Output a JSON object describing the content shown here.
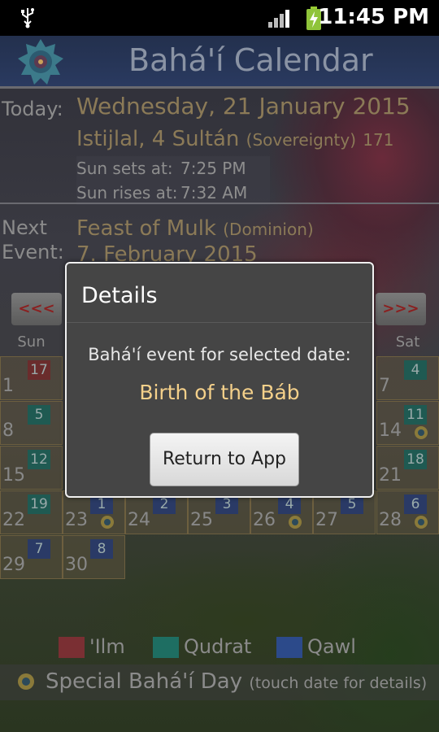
{
  "status": {
    "time": "11:45 PM"
  },
  "app": {
    "title": "Bahá'í Calendar"
  },
  "today": {
    "label": "Today:",
    "gregorian": "Wednesday, 21 January 2015",
    "badi_day": "Istijlal, 4 Sultán",
    "badi_month_meaning": "(Sovereignty)",
    "badi_year": "171",
    "sunset_label": "Sun sets at:",
    "sunset_time": "7:25 PM",
    "sunrise_label": "Sun rises at:",
    "sunrise_time": "7:32 AM"
  },
  "next_event": {
    "label_line1": "Next",
    "label_line2": "Event:",
    "name": "Feast of Mulk",
    "meaning": "(Dominion)",
    "date": "7. February 2015"
  },
  "nav": {
    "prev": "<<<",
    "next": ">>>"
  },
  "calendar": {
    "weekdays": [
      "Sun",
      "",
      "",
      "",
      "",
      "",
      "Sat"
    ],
    "cells": [
      {
        "day": "1",
        "badi": "17",
        "kind": "ilm"
      },
      {
        "day": "7",
        "badi": "4",
        "kind": "qudrat"
      },
      {
        "day": "8",
        "badi": "5",
        "kind": "qudrat"
      },
      {
        "day": "14",
        "badi": "11",
        "kind": "qudrat"
      },
      {
        "day": "15",
        "badi": "12",
        "kind": "qudrat"
      },
      {
        "day": "21",
        "badi": "18",
        "kind": "qudrat"
      },
      {
        "day": "22",
        "badi": "19",
        "kind": "qudrat"
      },
      {
        "day": "23",
        "badi": "1",
        "kind": "qawl"
      },
      {
        "day": "24",
        "badi": "2",
        "kind": "qawl"
      },
      {
        "day": "25",
        "badi": "3",
        "kind": "qawl"
      },
      {
        "day": "26",
        "badi": "4",
        "kind": "qawl"
      },
      {
        "day": "27",
        "badi": "5",
        "kind": "qawl"
      },
      {
        "day": "28",
        "badi": "6",
        "kind": "qawl"
      },
      {
        "day": "29",
        "badi": "7",
        "kind": "qawl"
      },
      {
        "day": "30",
        "badi": "8",
        "kind": "qawl"
      }
    ]
  },
  "legend": {
    "ilm": "'Ilm",
    "qudrat": "Qudrat",
    "qawl": "Qawl",
    "special": "Special Bahá'í Day",
    "special_hint": "(touch date for details)"
  },
  "colors": {
    "ilm": "#7a2f33",
    "qudrat": "#1e6e62",
    "qawl": "#2c4a8a",
    "event_text": "#f4d08a"
  },
  "dialog": {
    "title": "Details",
    "message": "Bahá'í event for selected date:",
    "event": "Birth of the Báb",
    "button": "Return to App"
  }
}
